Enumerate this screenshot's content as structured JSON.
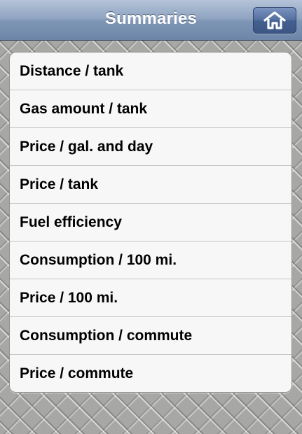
{
  "navbar": {
    "title": "Summaries",
    "home_button_icon": "home-icon"
  },
  "list": {
    "items": [
      {
        "label": "Distance / tank"
      },
      {
        "label": "Gas amount / tank"
      },
      {
        "label": "Price / gal. and day"
      },
      {
        "label": "Price / tank"
      },
      {
        "label": "Fuel efficiency"
      },
      {
        "label": "Consumption / 100 mi."
      },
      {
        "label": "Price / 100 mi."
      },
      {
        "label": "Consumption / commute"
      },
      {
        "label": "Price / commute"
      }
    ]
  },
  "colors": {
    "navbar_tint": "#8ea3c0",
    "button_tint": "#4a6695",
    "list_background": "#f7f7f7"
  }
}
